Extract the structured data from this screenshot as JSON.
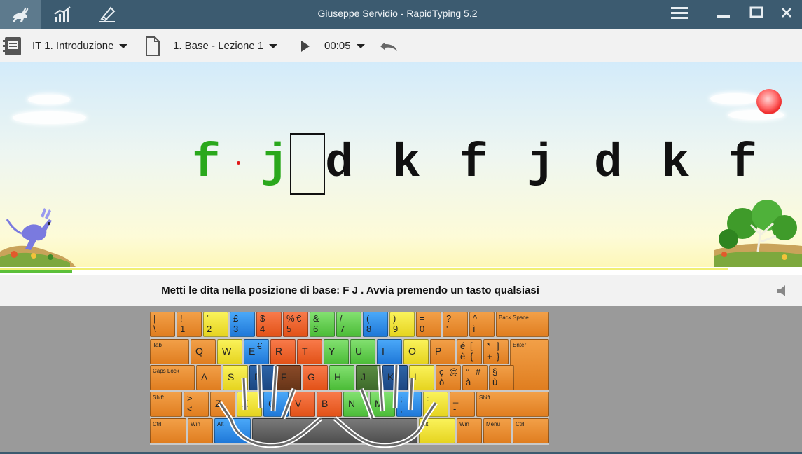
{
  "window": {
    "title": "Giuseppe Servidio - RapidTyping 5.2"
  },
  "tabs": [
    {
      "icon": "rabbit-icon",
      "active": true
    },
    {
      "icon": "statistics-icon",
      "active": false
    },
    {
      "icon": "editor-icon",
      "active": false
    }
  ],
  "toolbar": {
    "course": "IT 1. Introduzione",
    "lesson": "1. Base - Lezione 1",
    "timer": "00:05"
  },
  "exercise": {
    "letters": [
      "f",
      "j",
      "d",
      "k",
      "f",
      "j",
      "d",
      "k",
      "f"
    ],
    "typed_count": 2,
    "progress_fraction": 0.09
  },
  "instruction": "Metti le dita nella posizione di base:  F  J .  Avvia premendo un tasto qualsiasi",
  "keyboard": {
    "row1": [
      {
        "tl": "|",
        "bl": "\\"
      },
      {
        "tl": "!",
        "bl": "1"
      },
      {
        "tl": "\"",
        "bl": "2"
      },
      {
        "tl": "£",
        "bl": "3"
      },
      {
        "tl": "$",
        "bl": "4"
      },
      {
        "tl": "%",
        "bl": "5",
        "tr": "€"
      },
      {
        "tl": "&",
        "bl": "6"
      },
      {
        "tl": "/",
        "bl": "7"
      },
      {
        "tl": "(",
        "bl": "8"
      },
      {
        "tl": ")",
        "bl": "9"
      },
      {
        "tl": "=",
        "bl": "0"
      },
      {
        "tl": "?",
        "bl": "'"
      },
      {
        "tl": "^",
        "bl": "ì"
      },
      {
        "lbl": "Back Space"
      }
    ],
    "row2": [
      {
        "lbl": "Tab"
      },
      {
        "big": "Q"
      },
      {
        "big": "W"
      },
      {
        "big": "E",
        "tr": "€"
      },
      {
        "big": "R"
      },
      {
        "big": "T"
      },
      {
        "big": "Y"
      },
      {
        "big": "U"
      },
      {
        "big": "I"
      },
      {
        "big": "O"
      },
      {
        "big": "P"
      },
      {
        "tl": "é",
        "bl": "è",
        "tr": "[",
        "br": "{"
      },
      {
        "tl": "*",
        "bl": "+",
        "tr": "]",
        "br": "}"
      },
      {
        "lbl": "Enter"
      }
    ],
    "row3": [
      {
        "lbl": "Caps Lock"
      },
      {
        "big": "A"
      },
      {
        "big": "S"
      },
      {
        "big": "D"
      },
      {
        "big": "F"
      },
      {
        "big": "G"
      },
      {
        "big": "H"
      },
      {
        "big": "J"
      },
      {
        "big": "K"
      },
      {
        "big": "L"
      },
      {
        "tl": "ç",
        "bl": "ò",
        "tr": "@"
      },
      {
        "tl": "°",
        "bl": "à",
        "tr": "#"
      },
      {
        "tl": "§",
        "bl": "ù"
      }
    ],
    "row4": [
      {
        "lbl": "Shift"
      },
      {
        "tl": ">",
        "bl": "<"
      },
      {
        "big": "Z"
      },
      {
        "big": "X"
      },
      {
        "big": "C"
      },
      {
        "big": "V"
      },
      {
        "big": "B"
      },
      {
        "big": "N"
      },
      {
        "big": "M"
      },
      {
        "tl": ";",
        "bl": ","
      },
      {
        "tl": ":",
        "bl": "."
      },
      {
        "tl": "_",
        "bl": "-"
      },
      {
        "lbl": "Shift"
      }
    ],
    "row5": [
      {
        "lbl": "Ctrl"
      },
      {
        "lbl": "Win"
      },
      {
        "lbl": "Alt"
      },
      {
        "lbl": ""
      },
      {
        "lbl": "Alt"
      },
      {
        "lbl": "Win"
      },
      {
        "lbl": "Menu"
      },
      {
        "lbl": "Ctrl"
      }
    ]
  },
  "colors": {
    "titlebar": "#3c5b70",
    "typed_letter": "#2aa81c",
    "finger_pinky": "#e58a2a",
    "finger_ring": "#f0e43a",
    "finger_middle": "#2f8ce8",
    "finger_index": "#ef6a30",
    "finger_index_right": "#6cd058"
  }
}
